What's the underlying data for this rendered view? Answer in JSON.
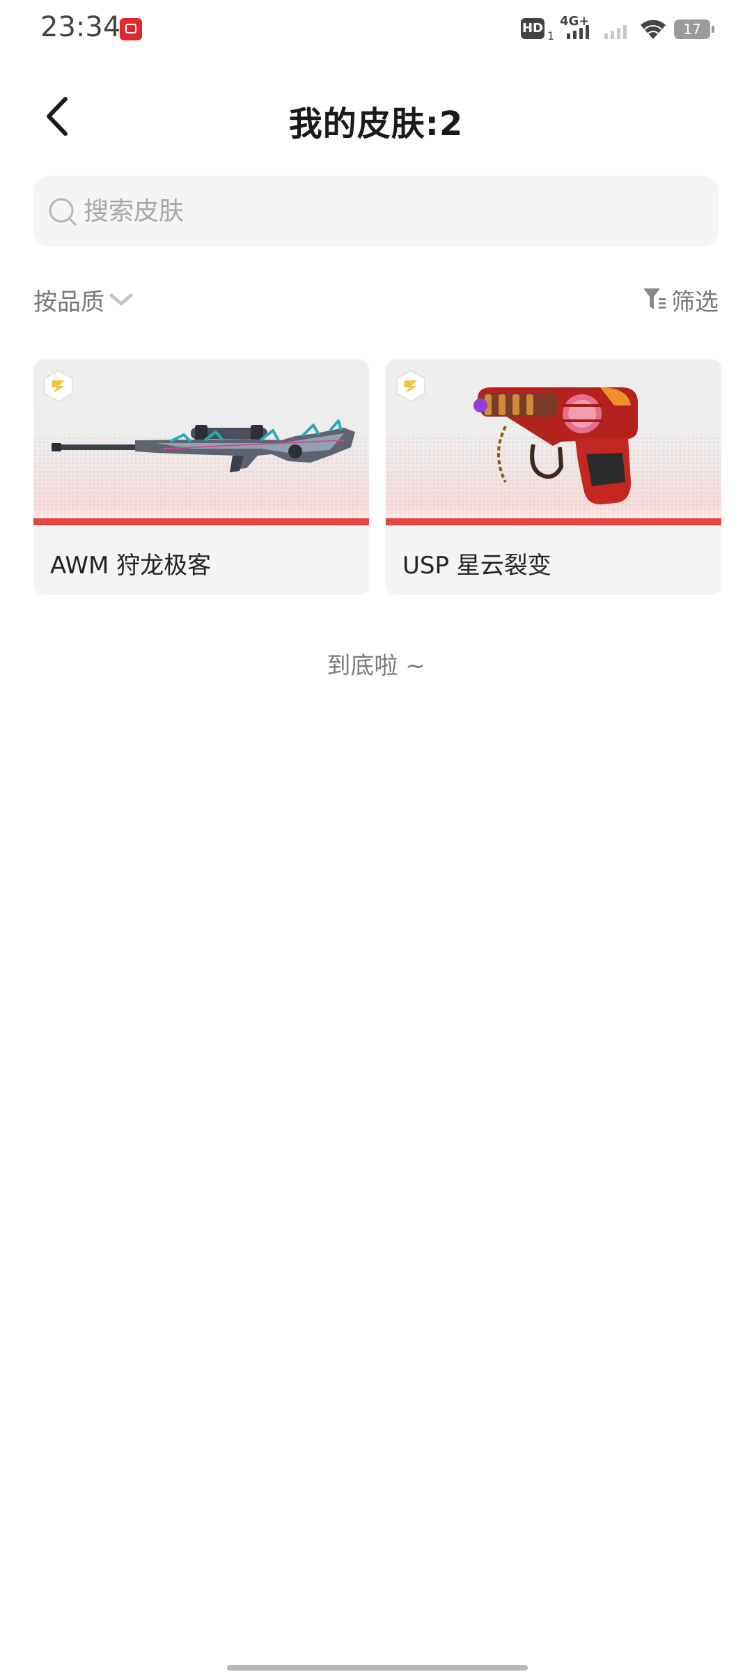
{
  "status_bar": {
    "time": "23:34",
    "hd_label": "HD",
    "hd_sub": "1",
    "network_label": "4G+",
    "battery_level": "17",
    "wifi_icon": "wifi-icon"
  },
  "header": {
    "title": "我的皮肤:2",
    "back_icon": "chevron-left-icon"
  },
  "search": {
    "placeholder": "搜索皮肤",
    "value": ""
  },
  "toolbar": {
    "sort_label": "按品质",
    "filter_label": "筛选"
  },
  "skins": [
    {
      "name": "AWM 狩龙极客",
      "rarity_color": "#e8433c",
      "weapon_icon": "sniper-rifle-icon"
    },
    {
      "name": "USP 星云裂变",
      "rarity_color": "#e8433c",
      "weapon_icon": "pistol-icon"
    }
  ],
  "list_footer": {
    "end_text": "到底啦 ~"
  },
  "colors": {
    "accent": "#e8433c",
    "badge_gold": "#f0c640",
    "text_muted": "#777777"
  }
}
